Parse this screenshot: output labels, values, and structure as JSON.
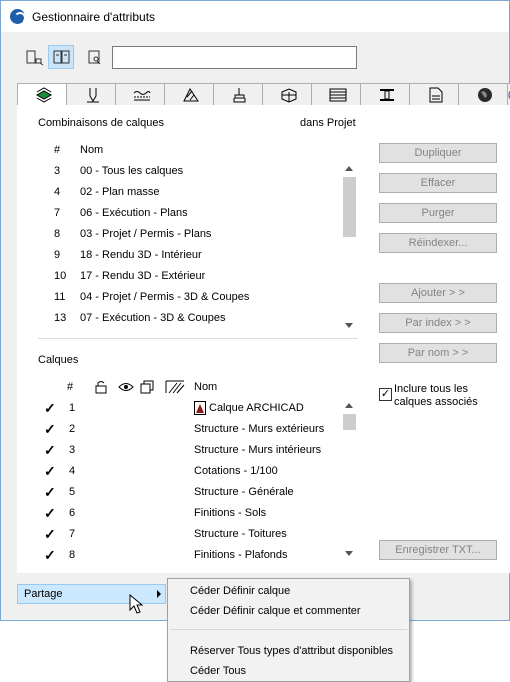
{
  "window": {
    "title": "Gestionnaire d'attributs"
  },
  "toolbar": {
    "views": [
      {
        "name": "view-left-icon"
      },
      {
        "name": "view-both-icon",
        "active": true
      },
      {
        "name": "view-right-icon"
      }
    ],
    "search": {
      "value": "",
      "placeholder": ""
    }
  },
  "tabs": [
    "layers-icon",
    "pen-icon",
    "line-icon",
    "fill-icon",
    "composite-icon",
    "profile-icon",
    "zone-icon",
    "beam-icon",
    "document-icon",
    "globe-icon",
    "more-icon"
  ],
  "combinations": {
    "title": "Combinaisons de calques",
    "subtitle": "dans Projet",
    "col_num": "#",
    "col_name": "Nom",
    "rows": [
      {
        "num": "3",
        "name": "00 - Tous les calques"
      },
      {
        "num": "4",
        "name": "02 - Plan masse"
      },
      {
        "num": "7",
        "name": "06 - Exécution - Plans"
      },
      {
        "num": "8",
        "name": "03 - Projet / Permis - Plans"
      },
      {
        "num": "9",
        "name": "18 - Rendu 3D - Intérieur"
      },
      {
        "num": "10",
        "name": "17 - Rendu 3D - Extérieur"
      },
      {
        "num": "11",
        "name": "04 - Projet / Permis - 3D & Coupes"
      },
      {
        "num": "13",
        "name": "07 - Exécution - 3D & Coupes"
      }
    ]
  },
  "layers": {
    "title": "Calques",
    "col_num": "#",
    "col_name": "Nom",
    "col_icons": [
      "lock-icon",
      "eye-icon",
      "copy-icon",
      "hatch-icon"
    ],
    "rows": [
      {
        "num": "1",
        "name": "Calque ARCHICAD",
        "checked": true,
        "special": true
      },
      {
        "num": "2",
        "name": "Structure - Murs extérieurs",
        "checked": true
      },
      {
        "num": "3",
        "name": "Structure - Murs intérieurs",
        "checked": true
      },
      {
        "num": "4",
        "name": "Cotations - 1/100",
        "checked": true
      },
      {
        "num": "5",
        "name": "Structure - Générale",
        "checked": true
      },
      {
        "num": "6",
        "name": "Finitions - Sols",
        "checked": true
      },
      {
        "num": "7",
        "name": "Structure - Toitures",
        "checked": true
      },
      {
        "num": "8",
        "name": "Finitions - Plafonds",
        "checked": true
      }
    ]
  },
  "buttons": {
    "duplicate": "Dupliquer",
    "delete": "Effacer",
    "purge": "Purger",
    "reindex": "Réindexer...",
    "add": "Ajouter > >",
    "by_index": "Par index > >",
    "by_name": "Par nom > >",
    "save_txt": "Enregistrer TXT..."
  },
  "include_all": {
    "label": "Inclure tous les calques associés",
    "checked": true
  },
  "partage": {
    "label": "Partage"
  },
  "context_menu": {
    "items": [
      "Céder Définir calque",
      "Céder Définir calque et commenter",
      "Réserver Tous types d'attribut disponibles",
      "Céder Tous"
    ]
  },
  "colors": {
    "selected": "#cce8ff",
    "button_disabled_text": "#838383",
    "app_icon": "#1f5ea8"
  }
}
